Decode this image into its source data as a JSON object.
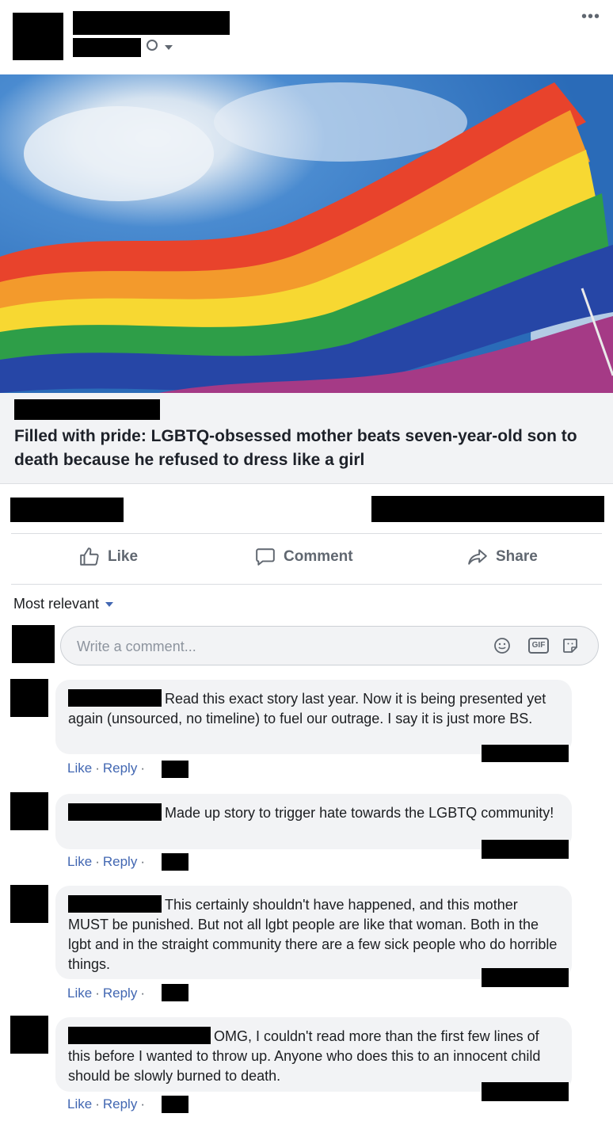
{
  "post": {
    "more_label": "•••",
    "headline": "Filled with pride: LGBTQ-obsessed mother beats seven-year-old son to death because he refused to dress like a girl"
  },
  "actions": {
    "like": "Like",
    "comment": "Comment",
    "share": "Share"
  },
  "sort": {
    "label": "Most relevant"
  },
  "composer": {
    "placeholder": "Write a comment...",
    "icons": [
      "emoji-icon",
      "gif-icon",
      "sticker-icon"
    ],
    "gif_label": "GIF"
  },
  "comments": [
    {
      "text": "Read this exact story last year. Now it is being presented yet again (unsourced, no timeline) to fuel our outrage. I say it is just more BS.",
      "like": "Like",
      "reply": "Reply",
      "sep": "·"
    },
    {
      "text": "Made up story to trigger hate towards the LGBTQ community!",
      "like": "Like",
      "reply": "Reply",
      "sep": "·"
    },
    {
      "text": "This certainly shouldn't have happened, and this mother MUST be punished. But not all lgbt people are like that woman. Both in the lgbt and in the straight community there are a few sick people who do horrible things.",
      "like": "Like",
      "reply": "Reply",
      "sep": "·"
    },
    {
      "text": "OMG, I couldn't read more than the first few lines of this before I wanted to throw up. Anyone who does this to an innocent child should be slowly burned to death.",
      "like": "Like",
      "reply": "Reply",
      "sep": "·"
    }
  ],
  "colors": {
    "link_blue": "#4267b2",
    "bubble_bg": "#f2f3f5",
    "muted": "#606770"
  }
}
